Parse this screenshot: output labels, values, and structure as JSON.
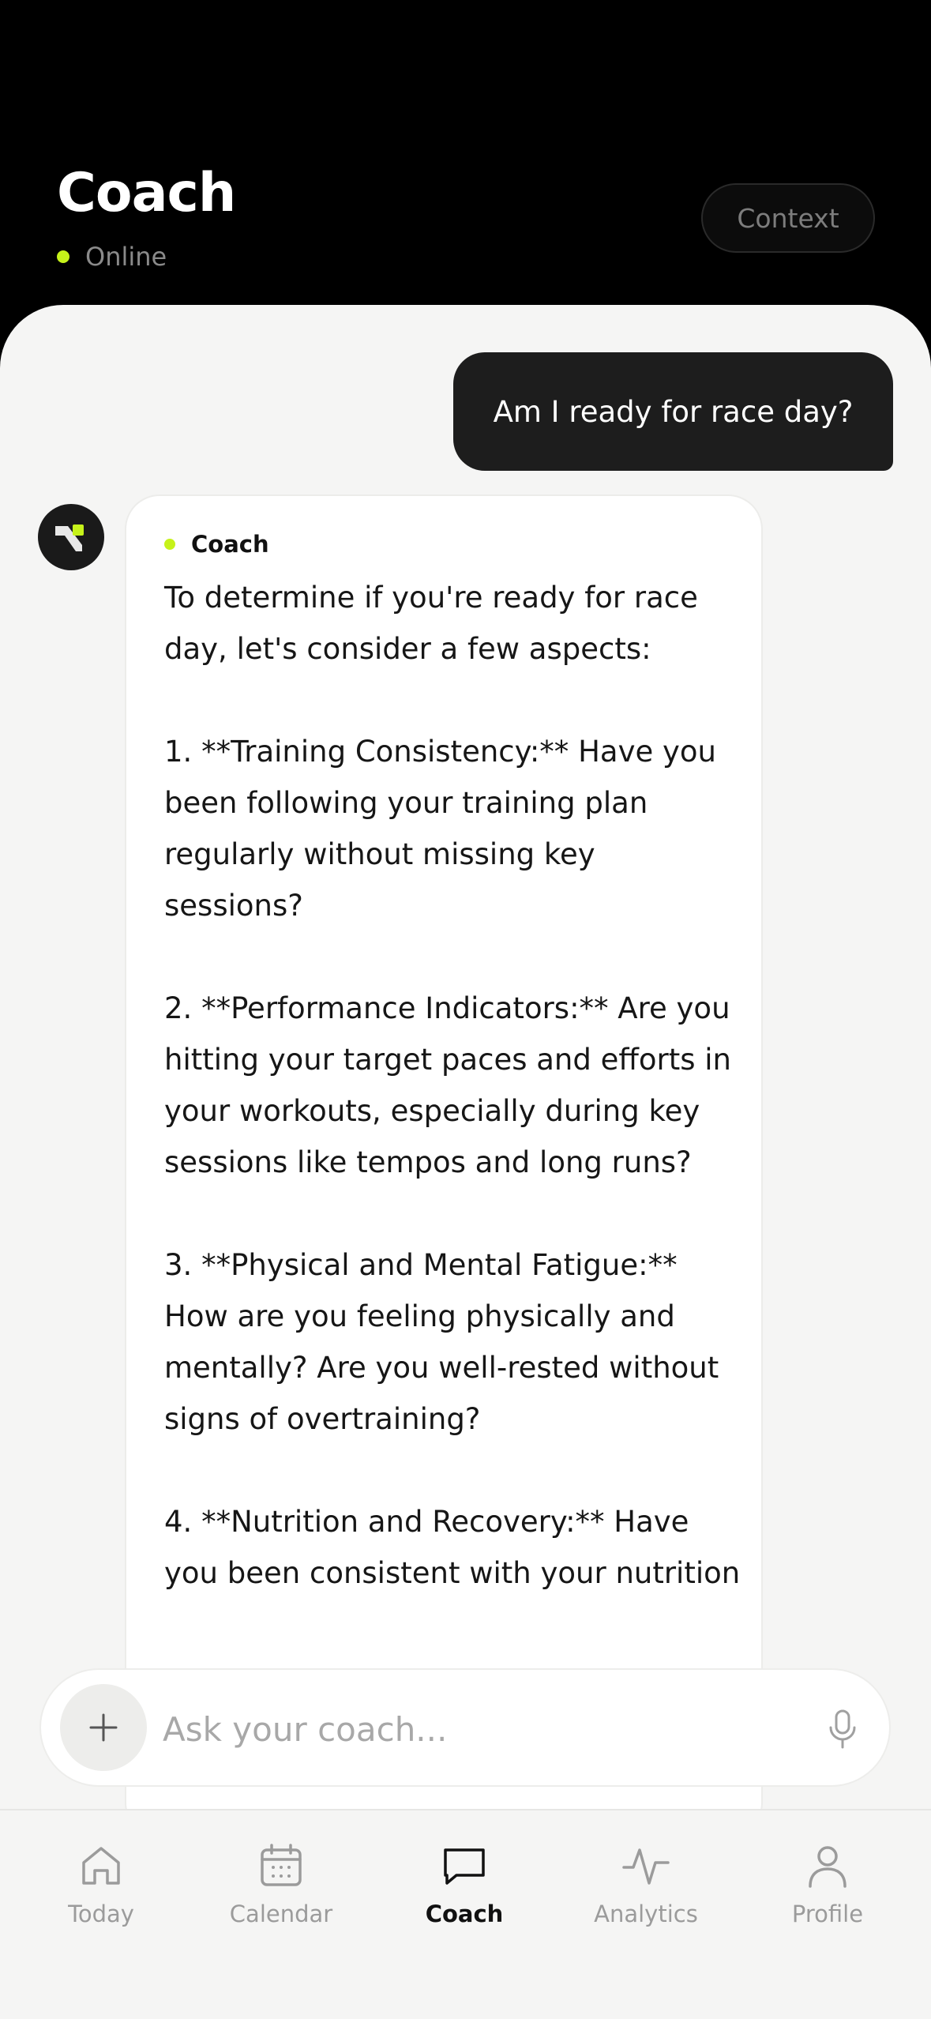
{
  "header": {
    "title": "Coach",
    "status": "Online",
    "context_button": "Context"
  },
  "chat": {
    "user_message": "Am I ready for race day?",
    "coach_label": "Coach",
    "coach_message": "To determine if you're ready for race day, let's consider a few aspects:\n\n1. **Training Consistency:** Have you been following your training plan regularly without missing key sessions?\n\n2. **Performance Indicators:** Are you hitting your target paces and efforts in your workouts, especially during key sessions like tempos and long runs?\n\n3. **Physical and Mental Fatigue:** How are you feeling physically and mentally? Are you well-rested without signs of overtraining?\n\n4. **Nutrition and Recovery:** Have you been consistent with your nutrition"
  },
  "composer": {
    "placeholder": "Ask your coach..."
  },
  "tabs": [
    {
      "label": "Today",
      "icon": "home-icon"
    },
    {
      "label": "Calendar",
      "icon": "calendar-icon"
    },
    {
      "label": "Coach",
      "icon": "chat-icon",
      "active": true
    },
    {
      "label": "Analytics",
      "icon": "activity-icon"
    },
    {
      "label": "Profile",
      "icon": "person-icon"
    }
  ],
  "colors": {
    "accent": "#c6f21a",
    "header_bg": "#000000",
    "sheet_bg": "#f5f5f4",
    "user_bubble": "#1d1d1d"
  }
}
